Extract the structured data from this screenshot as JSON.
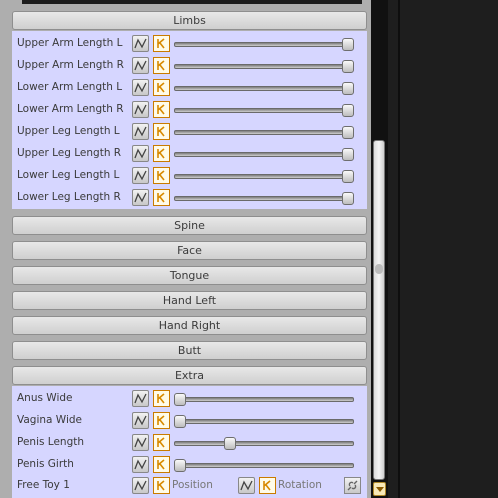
{
  "sections": {
    "limbs": "Limbs",
    "spine": "Spine",
    "face": "Face",
    "tongue": "Tongue",
    "hand_left": "Hand Left",
    "hand_right": "Hand Right",
    "butt": "Butt",
    "extra": "Extra"
  },
  "limbs_rows": [
    {
      "label": "Upper Arm Length L",
      "value_fraction": 1.0
    },
    {
      "label": "Upper Arm Length R",
      "value_fraction": 1.0
    },
    {
      "label": "Lower Arm Length L",
      "value_fraction": 1.0
    },
    {
      "label": "Lower Arm Length R",
      "value_fraction": 1.0
    },
    {
      "label": "Upper Leg Length L",
      "value_fraction": 1.0
    },
    {
      "label": "Upper Leg Length R",
      "value_fraction": 1.0
    },
    {
      "label": "Lower Leg Length L",
      "value_fraction": 1.0
    },
    {
      "label": "Lower Leg Length R",
      "value_fraction": 1.0
    }
  ],
  "extra_rows": [
    {
      "label": "Anus Wide",
      "value_fraction": 0.0
    },
    {
      "label": "Vagina Wide",
      "value_fraction": 0.0
    },
    {
      "label": "Penis Length",
      "value_fraction": 0.3
    },
    {
      "label": "Penis Girth",
      "value_fraction": 0.0
    }
  ],
  "free_toy": {
    "label": "Free Toy 1",
    "position_label": "Position",
    "rotation_label": "Rotation"
  },
  "icons": {
    "curve": "curve-icon",
    "key": "key-icon",
    "link": "link-icon",
    "scroll_down": "chevron-down-icon"
  },
  "colors": {
    "panel_bg": "#aeaeae",
    "row_bg": "#d6d6ff",
    "key_accent": "#d88a00"
  }
}
